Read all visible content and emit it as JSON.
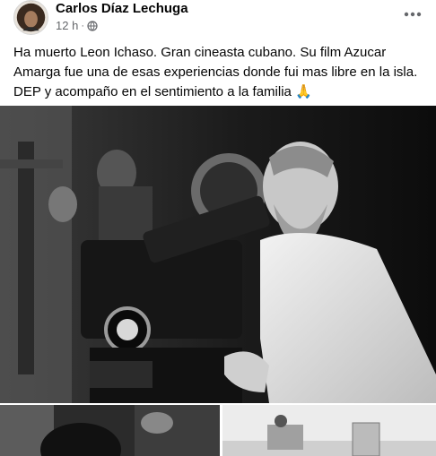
{
  "post": {
    "author": "Carlos Díaz Lechuga",
    "timestamp": "12 h",
    "separator": "·",
    "audience_icon": "globe-icon",
    "text": "Ha muerto Leon Ichaso. Gran cineasta cubano. Su film Azucar Amarga fue una de esas experiencias donde fui mas libre en la isla. DEP y acompaño en el sentimiento a la familia 🙏",
    "more_icon": "more-options-icon"
  },
  "colors": {
    "text_primary": "#050505",
    "text_secondary": "#65676b",
    "background": "#ffffff"
  }
}
